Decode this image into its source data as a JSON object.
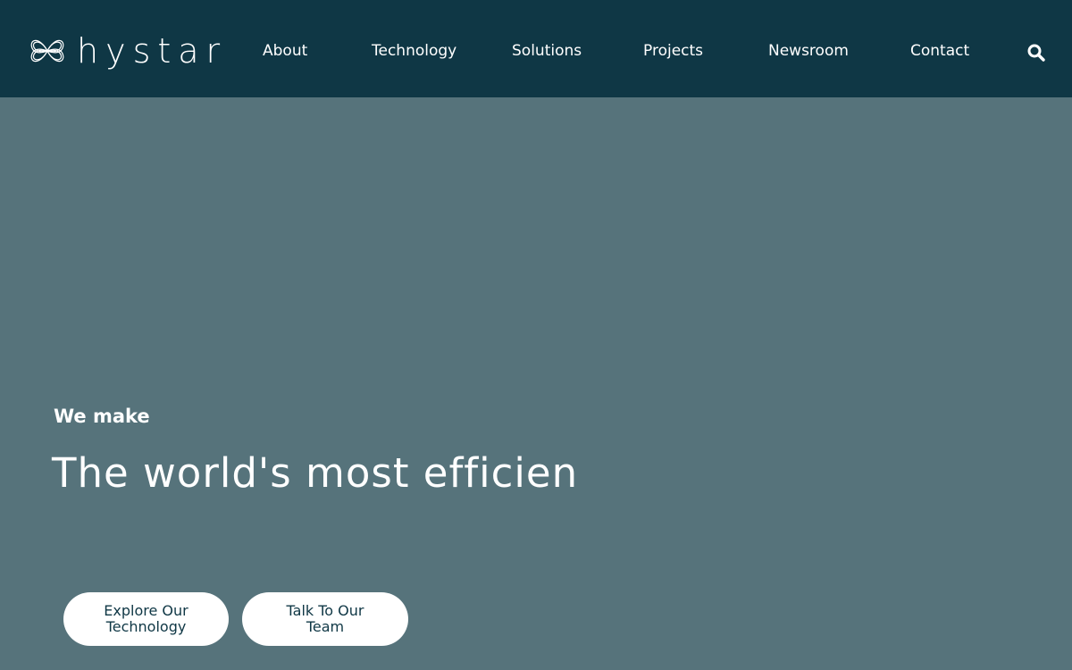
{
  "header": {
    "brand": {
      "name": "hystar",
      "icon": "clover-logo-icon"
    },
    "nav": [
      {
        "label": "About"
      },
      {
        "label": "Technology"
      },
      {
        "label": "Solutions"
      },
      {
        "label": "Projects"
      },
      {
        "label": "Newsroom"
      },
      {
        "label": "Contact"
      }
    ],
    "search_icon": "search-icon"
  },
  "hero": {
    "eyebrow": "We make",
    "headline": "The world's most efficien",
    "buttons": [
      {
        "line1": "Explore Our",
        "line2": "Technology"
      },
      {
        "line1": "Talk To Our",
        "line2": "Team"
      }
    ]
  },
  "colors": {
    "header_bg": "#0f3745",
    "hero_bg": "#56737b",
    "button_bg": "#ffffff",
    "button_text": "#0f3745",
    "text": "#ffffff"
  }
}
